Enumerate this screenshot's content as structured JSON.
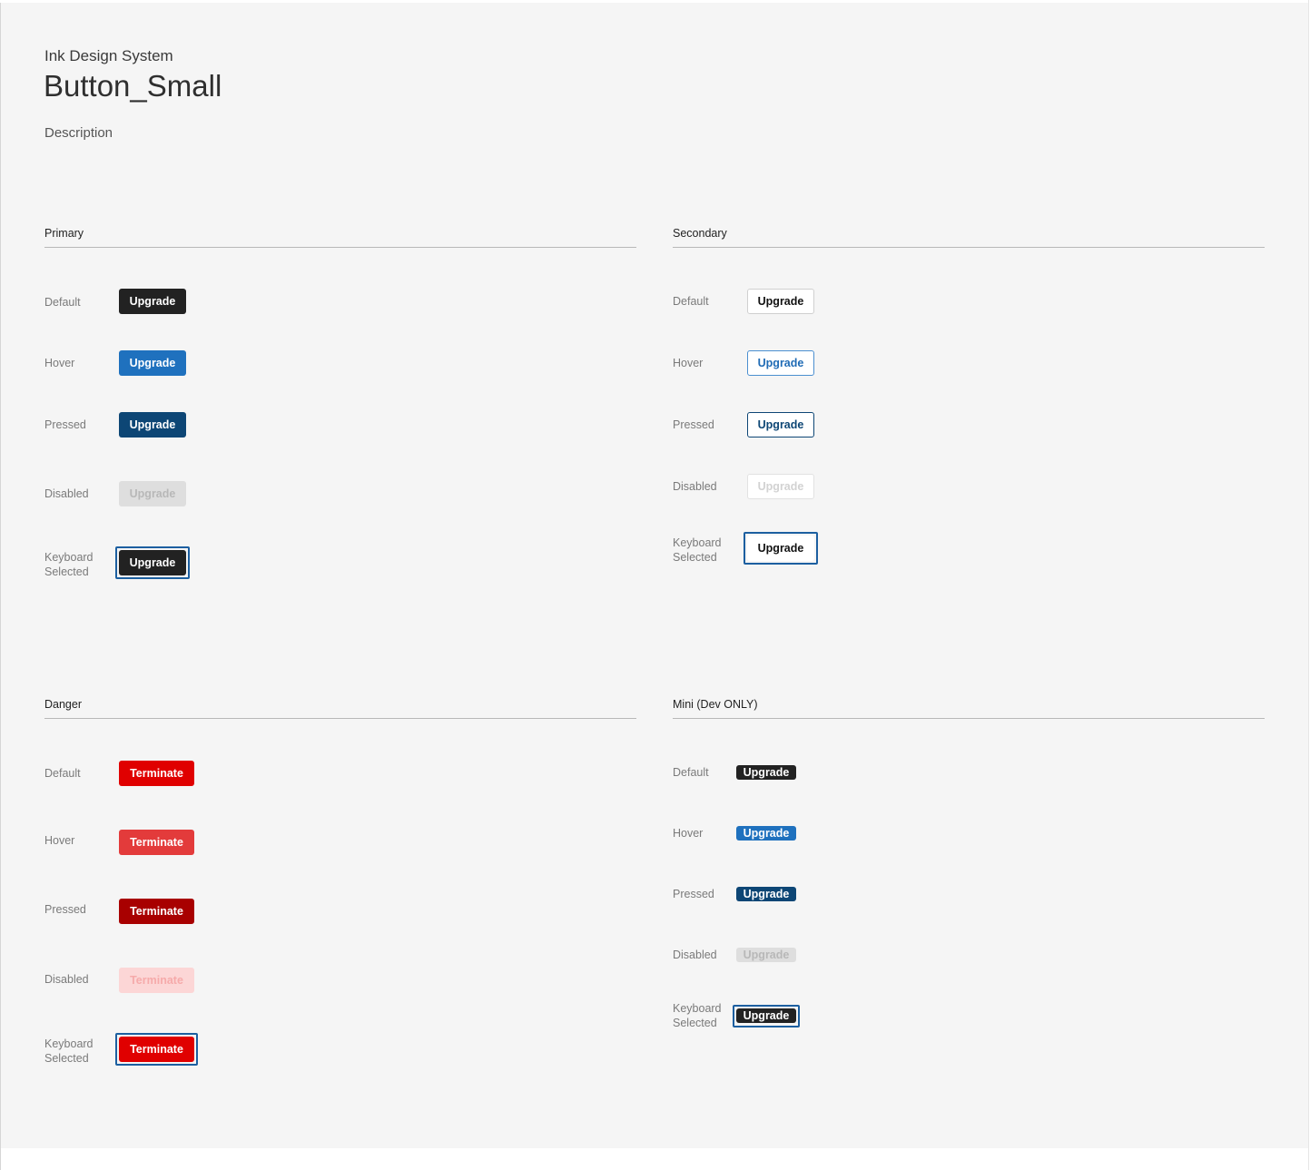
{
  "header": {
    "system_name": "Ink Design System",
    "title": "Button_Small",
    "description": "Description"
  },
  "sections": {
    "primary": {
      "title": "Primary",
      "states": {
        "default": "Default",
        "hover": "Hover",
        "pressed": "Pressed",
        "disabled": "Disabled",
        "keyboard_1": "Keyboard",
        "keyboard_2": "Selected"
      },
      "button_label": "Upgrade",
      "colors": {
        "default": "#222222",
        "hover": "#1f71be",
        "pressed": "#0d4675",
        "disabled": "#dedede",
        "focus_ring": "#1c5fa0"
      }
    },
    "secondary": {
      "title": "Secondary",
      "states": {
        "default": "Default",
        "hover": "Hover",
        "pressed": "Pressed",
        "disabled": "Disabled",
        "keyboard_1": "Keyboard",
        "keyboard_2": "Selected"
      },
      "button_label": "Upgrade",
      "colors": {
        "background": "#ffffff",
        "hover_text": "#1f6bb5",
        "pressed_text": "#0d4675"
      }
    },
    "danger": {
      "title": "Danger",
      "states": {
        "default": "Default",
        "hover": "Hover",
        "pressed": "Pressed",
        "disabled": "Disabled",
        "keyboard_1": "Keyboard",
        "keyboard_2": "Selected"
      },
      "button_label": "Terminate",
      "colors": {
        "default": "#e00000",
        "hover": "#e33b3b",
        "pressed": "#a80000",
        "disabled": "#fcd6d6"
      }
    },
    "mini": {
      "title": "Mini (Dev ONLY)",
      "states": {
        "default": "Default",
        "hover": "Hover",
        "pressed": "Pressed",
        "disabled": "Disabled",
        "keyboard_1": "Keyboard",
        "keyboard_2": "Selected"
      },
      "button_label": "Upgrade"
    }
  }
}
